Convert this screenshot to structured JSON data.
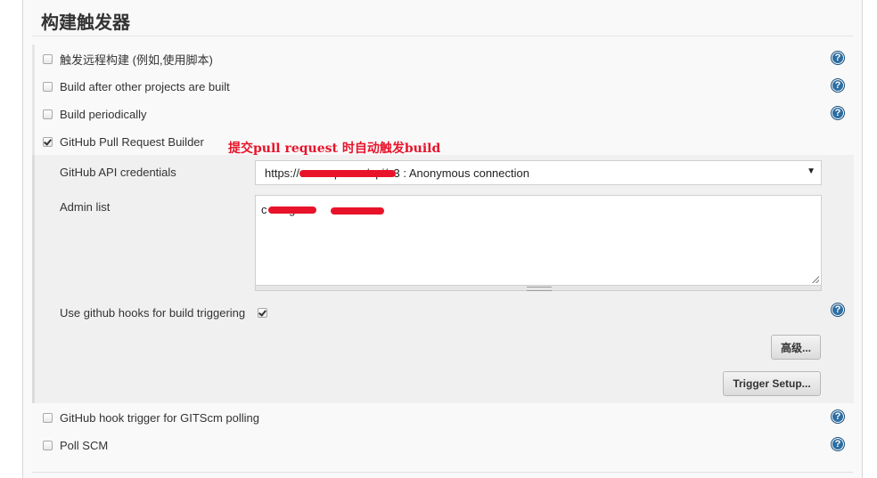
{
  "section": {
    "title": "构建触发器"
  },
  "triggers": [
    {
      "label": "触发远程构建 (例如,使用脚本)",
      "checked": false
    },
    {
      "label": "Build after other projects are built",
      "checked": false
    },
    {
      "label": "Build periodically",
      "checked": false
    },
    {
      "label": "GitHub Pull Request Builder",
      "checked": true
    },
    {
      "label": "GitHub hook trigger for GITScm polling",
      "checked": false
    },
    {
      "label": "Poll SCM",
      "checked": false
    }
  ],
  "annotation": "提交pull request 时自动触发build",
  "ghprb": {
    "credentials_label": "GitHub API credentials",
    "credentials_value": "https://c               rscorp.com/api/v3 : Anonymous connection",
    "admin_list_label": "Admin list",
    "admin_list_value": "c                n  z                g",
    "use_hooks_label": "Use github hooks for build triggering",
    "use_hooks_checked": true,
    "advanced_button": "高级...",
    "trigger_setup_button": "Trigger Setup..."
  },
  "icons": {
    "help": "help-icon",
    "checkbox": "checkbox-icon",
    "dropdown": "chevron-down-icon"
  },
  "colors": {
    "accent_help": "#2c6ea3",
    "annotation_red": "#e8132a"
  }
}
